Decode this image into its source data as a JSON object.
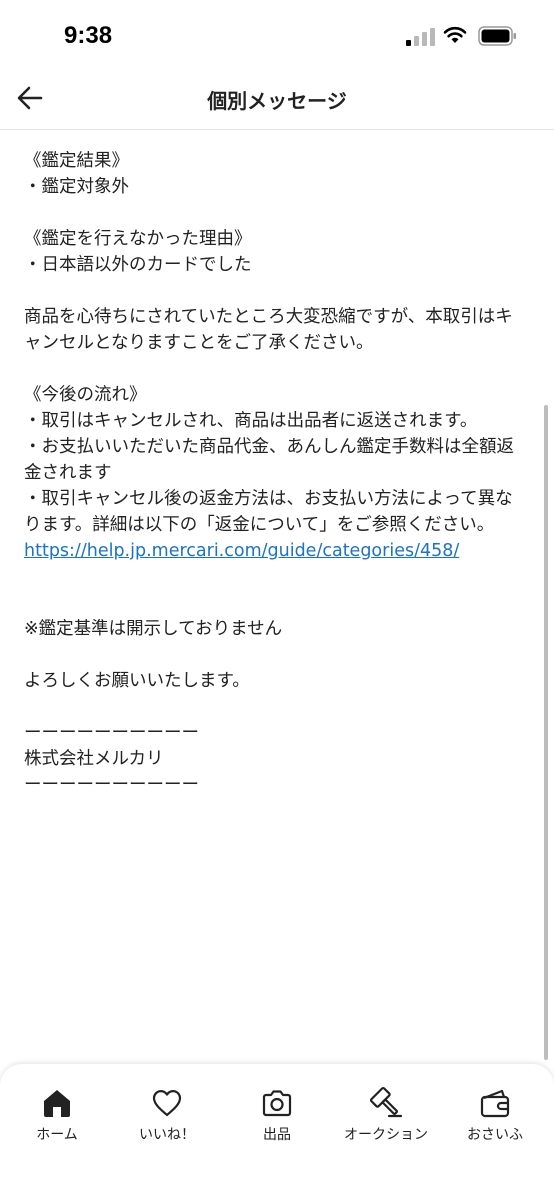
{
  "status_bar": {
    "time": "9:38"
  },
  "header": {
    "title": "個別メッセージ",
    "back_icon": "arrow-left-icon"
  },
  "message": {
    "paragraphs": [
      [
        "《鑑定結果》",
        "・鑑定対象外"
      ],
      [
        "《鑑定を行えなかった理由》",
        "・日本語以外のカードでした"
      ],
      [
        "商品を心待ちにされていたところ大変恐縮ですが、本取引はキャンセルとなりますことをご了承ください。"
      ],
      [
        "《今後の流れ》",
        "・取引はキャンセルされ、商品は出品者に返送されます。",
        "・お支払いいただいた商品代金、あんしん鑑定手数料は全額返金されます",
        "・取引キャンセル後の返金方法は、お支払い方法によって異なります。詳細は以下の「返金について」をご参照ください。"
      ]
    ],
    "link": "https://help.jp.mercari.com/guide/categories/458/",
    "notice": "※鑑定基準は開示しておりません",
    "closing": "よろしくお願いいたします。",
    "signature": {
      "divider_top": "ーーーーーーーーーー",
      "company": "株式会社メルカリ",
      "divider_bottom": "ーーーーーーーーーー"
    }
  },
  "tab_bar": {
    "tabs": [
      {
        "label": "ホーム",
        "icon": "home-icon"
      },
      {
        "label": "いいね！",
        "icon": "heart-icon"
      },
      {
        "label": "出品",
        "icon": "camera-icon"
      },
      {
        "label": "オークション",
        "icon": "gavel-icon"
      },
      {
        "label": "おさいふ",
        "icon": "wallet-icon"
      }
    ]
  },
  "colors": {
    "link": "#1a73c8",
    "text": "#222222"
  }
}
